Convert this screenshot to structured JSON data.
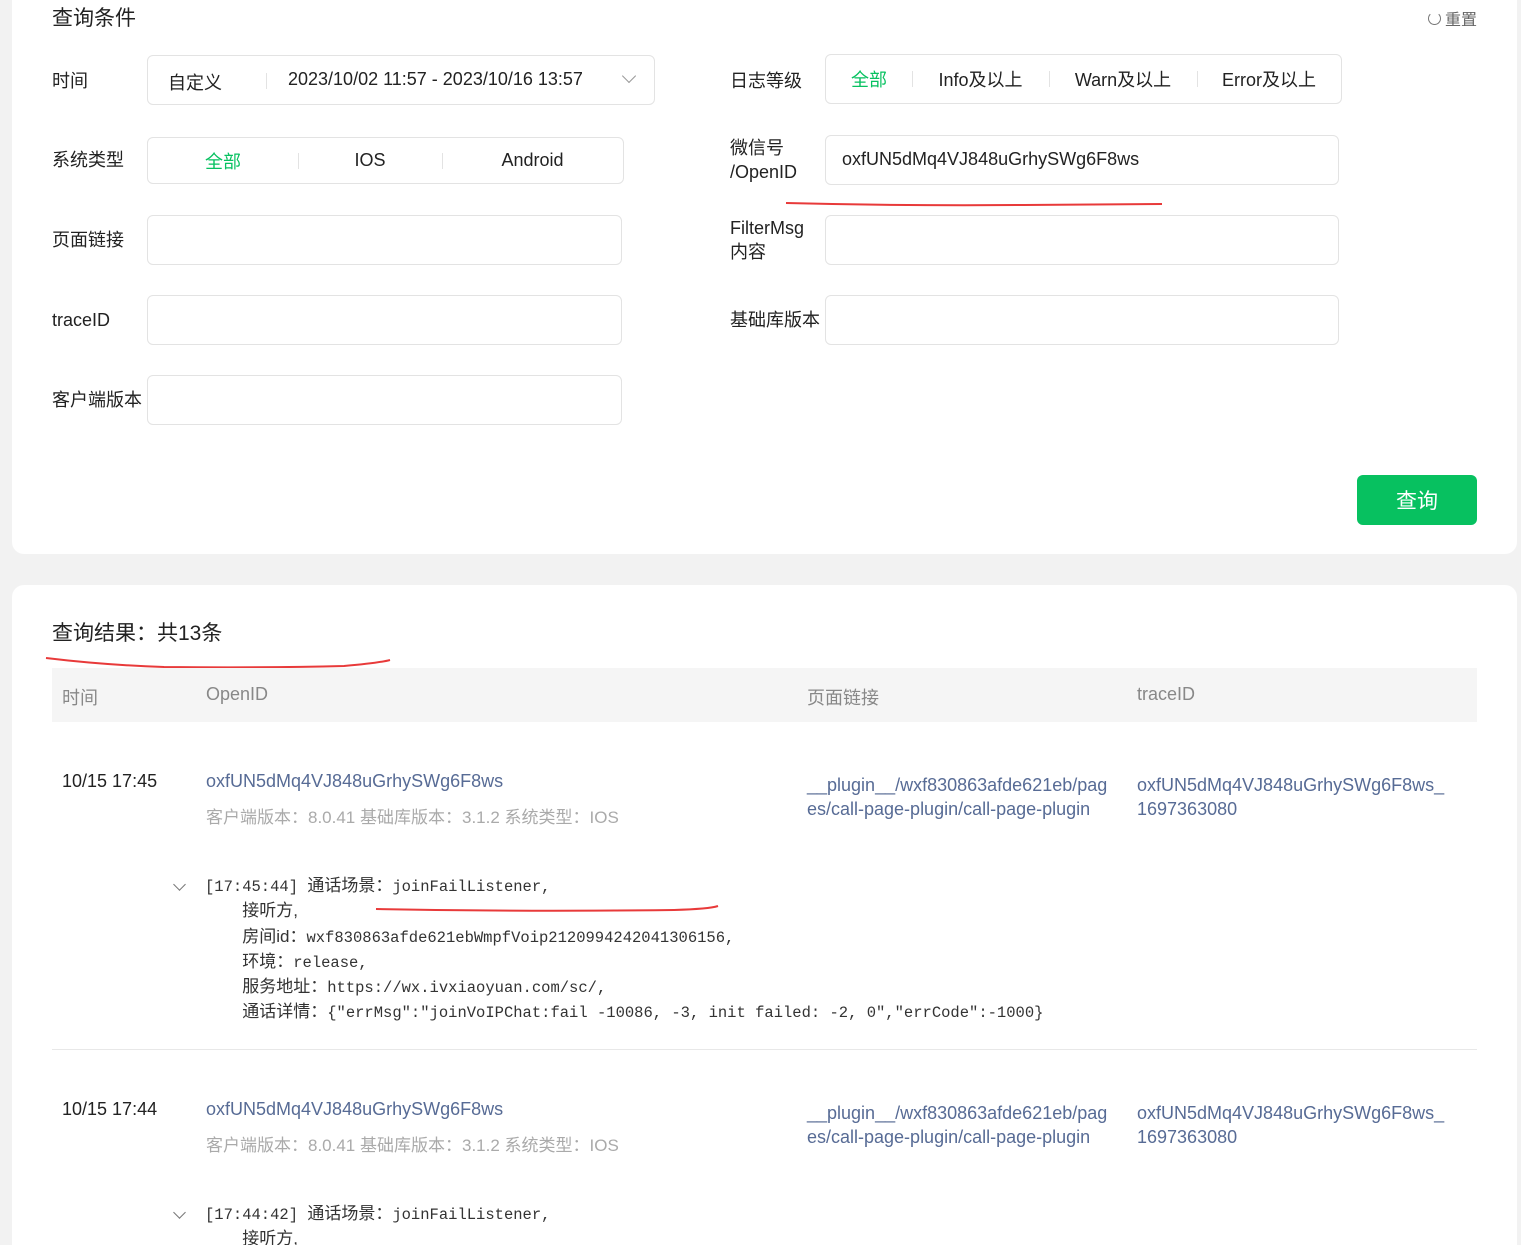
{
  "query": {
    "title": "查询条件",
    "reset_label": "重置",
    "time_label": "时间",
    "time_mode": "自定义",
    "time_range": "2023/10/02 11:57 - 2023/10/16 13:57",
    "log_level_label": "日志等级",
    "log_levels": [
      "全部",
      "Info及以上",
      "Warn及以上",
      "Error及以上"
    ],
    "os_label": "系统类型",
    "os_options": [
      "全部",
      "IOS",
      "Android"
    ],
    "wechat_label_line1": "微信号",
    "wechat_label_line2": "/OpenID",
    "wechat_value": "oxfUN5dMq4VJ848uGrhySWg6F8ws",
    "page_link_label": "页面链接",
    "filter_label_line1": "FilterMsg",
    "filter_label_line2": "内容",
    "trace_label": "traceID",
    "lib_version_label": "基础库版本",
    "client_version_label": "客户端版本",
    "submit_label": "查询"
  },
  "results": {
    "title": "查询结果：共13条",
    "columns": [
      "时间",
      "OpenID",
      "页面链接",
      "traceID"
    ],
    "rows": [
      {
        "time": "10/15 17:45",
        "openid": "oxfUN5dMq4VJ848uGrhySWg6F8ws",
        "meta": "客户端版本：8.0.41 基础库版本：3.1.2 系统类型：IOS",
        "page_line1": "__plugin__/wxf830863afde621eb/pag",
        "page_line2": "es/call-page-plugin/call-page-plugin",
        "trace_line1": "oxfUN5dMq4VJ848uGrhySWg6F8ws_",
        "trace_line2": "1697363080",
        "log": {
          "ts": "[17:45:44]",
          "scene_label": "通话场景：",
          "scene_value": "joinFailListener,",
          "answer_label": "接听方,",
          "room_label": "房间id：",
          "room_value": "wxf830863afde621ebWmpfVoip2120994242041306156,",
          "env_label": "环境：",
          "env_value": "release,",
          "service_label": "服务地址：",
          "service_value": "https://wx.ivxiaoyuan.com/sc/,",
          "detail_label": "通话详情：",
          "detail_value": "{\"errMsg\":\"joinVoIPChat:fail -10086, -3, init failed: -2, 0\",\"errCode\":-1000}"
        }
      },
      {
        "time": "10/15 17:44",
        "openid": "oxfUN5dMq4VJ848uGrhySWg6F8ws",
        "meta": "客户端版本：8.0.41 基础库版本：3.1.2 系统类型：IOS",
        "page_line1": "__plugin__/wxf830863afde621eb/pag",
        "page_line2": "es/call-page-plugin/call-page-plugin",
        "trace_line1": "oxfUN5dMq4VJ848uGrhySWg6F8ws_",
        "trace_line2": "1697363080",
        "log": {
          "ts": "[17:44:42]",
          "scene_label": "通话场景：",
          "scene_value": "joinFailListener,",
          "answer_label": "接听方,"
        }
      }
    ]
  },
  "colors": {
    "accent": "#07c160",
    "link": "#576b95",
    "annotation": "#e83a3a"
  }
}
